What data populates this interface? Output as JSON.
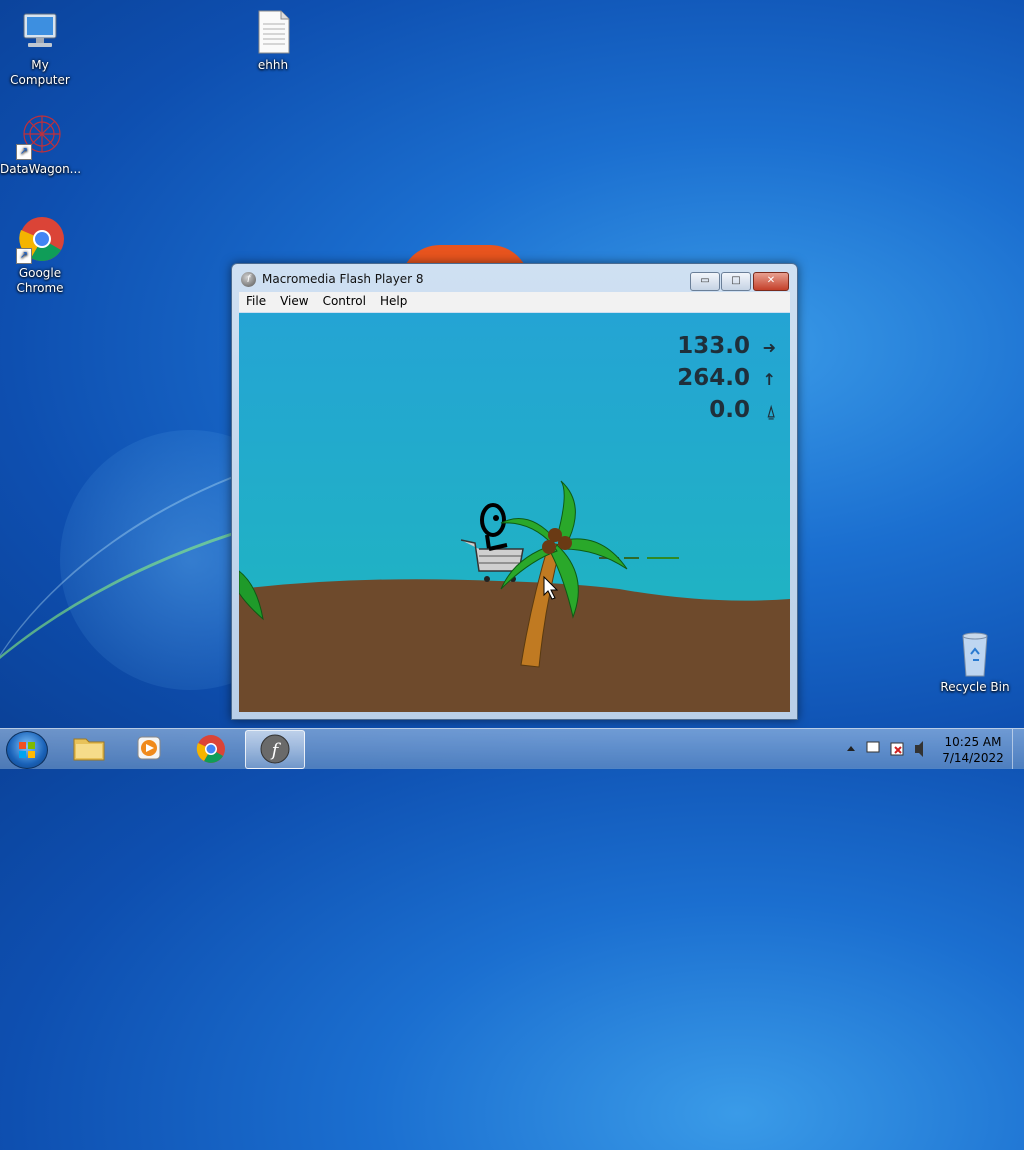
{
  "desktop": {
    "icons": [
      {
        "label": "My Computer"
      },
      {
        "label": "ehhh"
      },
      {
        "label": "DataWagon..."
      },
      {
        "label": "Google Chrome"
      },
      {
        "label": "Recycle Bin"
      }
    ]
  },
  "window": {
    "title": "Macromedia Flash Player 8",
    "controls": {
      "minimize": "▭",
      "maximize": "□",
      "close": "✕"
    },
    "menu": [
      "File",
      "View",
      "Control",
      "Help"
    ]
  },
  "game": {
    "hud": {
      "horizontal_speed": "133.0",
      "vertical_speed": "264.0",
      "third_value": "0.0"
    },
    "icons": {
      "right_arrow": "➜",
      "up_arrow": "↑",
      "third": "⍙"
    }
  },
  "taskbar": {
    "pinned": [
      "start-button",
      "windows-explorer",
      "windows-media-player",
      "google-chrome",
      "flash-player"
    ],
    "clock": {
      "time": "10:25 AM",
      "date": "7/14/2022"
    }
  }
}
